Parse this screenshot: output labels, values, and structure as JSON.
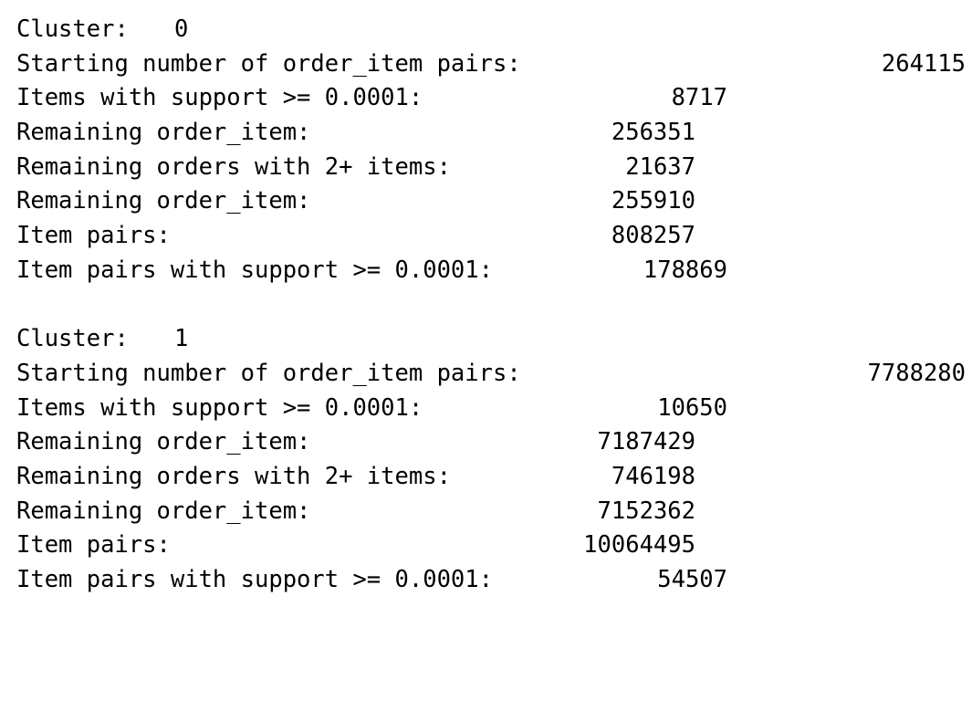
{
  "clusters": [
    {
      "cluster_label": "Cluster:",
      "cluster_id": "0",
      "rows": [
        {
          "label": "Starting number of order_item pairs:",
          "value": "264115"
        },
        {
          "label": "Items with support >= 0.0001:",
          "value": "8717"
        },
        {
          "label": "Remaining order_item:",
          "value": "256351"
        },
        {
          "label": "Remaining orders with 2+ items:",
          "value": "21637"
        },
        {
          "label": "Remaining order_item:",
          "value": "255910"
        },
        {
          "label": "Item pairs:",
          "value": "808257"
        },
        {
          "label": "Item pairs with support >= 0.0001:",
          "value": "178869"
        }
      ]
    },
    {
      "cluster_label": "Cluster:",
      "cluster_id": "1",
      "rows": [
        {
          "label": "Starting number of order_item pairs:",
          "value": "7788280"
        },
        {
          "label": "Items with support >= 0.0001:",
          "value": "10650"
        },
        {
          "label": "Remaining order_item:",
          "value": "7187429"
        },
        {
          "label": "Remaining orders with 2+ items:",
          "value": "746198"
        },
        {
          "label": "Remaining order_item:",
          "value": "7152362"
        },
        {
          "label": "Item pairs:",
          "value": "10064495"
        },
        {
          "label": "Item pairs with support >= 0.0001:",
          "value": "54507"
        }
      ]
    }
  ]
}
